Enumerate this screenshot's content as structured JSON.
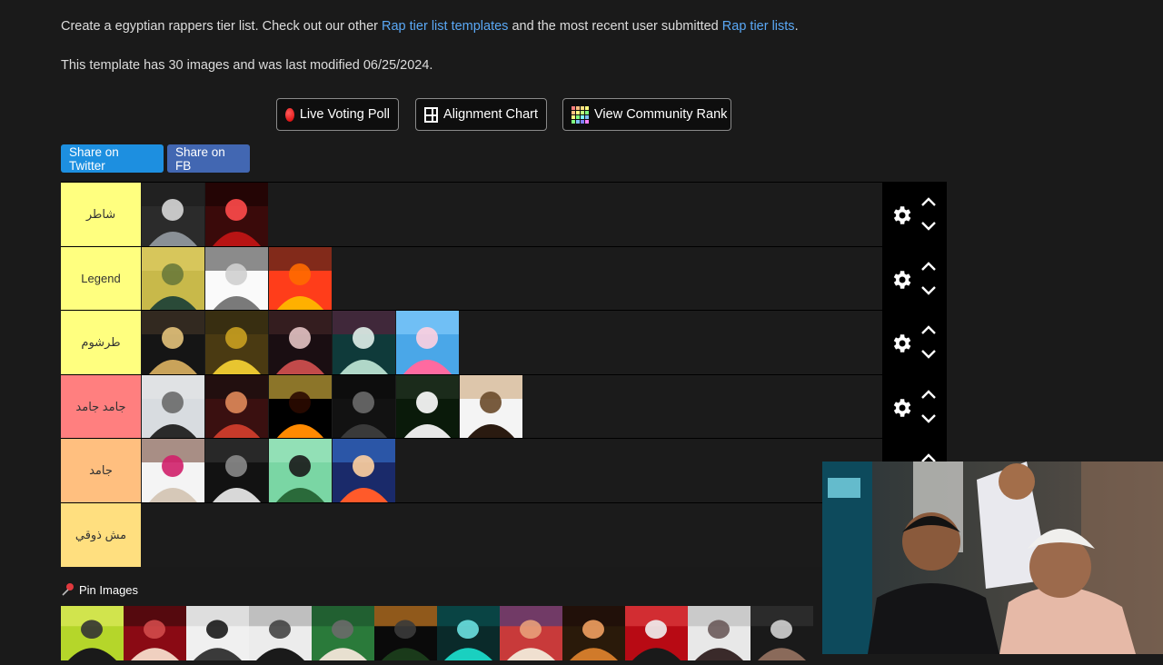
{
  "intro": {
    "prefix": "Create a egyptian rappers tier list. Check out our other ",
    "link1": "Rap tier list templates",
    "middle": " and the most recent user submitted ",
    "link2": "Rap tier lists",
    "suffix": "."
  },
  "meta": "This template has 30 images and was last modified 06/25/2024.",
  "buttons": {
    "live_voting": "Live Voting Poll",
    "alignment": "Alignment Chart",
    "community": "View Community Rank",
    "share_twitter": "Share on Twitter",
    "share_fb": "Share on FB"
  },
  "colors": {
    "accent_link": "#5aa8f5",
    "twitter": "#1d8fe0",
    "facebook": "#4267b2"
  },
  "tiers": [
    {
      "label": "شاطر",
      "color": "#ffff7f",
      "count": 2
    },
    {
      "label": "Legend",
      "color": "#ffff7f",
      "count": 3
    },
    {
      "label": "طرشوم",
      "color": "#ffff7f",
      "count": 5
    },
    {
      "label": "جامد جامد",
      "color": "#ff7f7f",
      "count": 6
    },
    {
      "label": "جامد",
      "color": "#ffbf7f",
      "count": 4
    },
    {
      "label": "مش ذوقي",
      "color": "#ffdf7f",
      "count": 0
    }
  ],
  "pin_images": {
    "label": "Pin Images",
    "icon": "pushpin-icon",
    "count": 12
  }
}
